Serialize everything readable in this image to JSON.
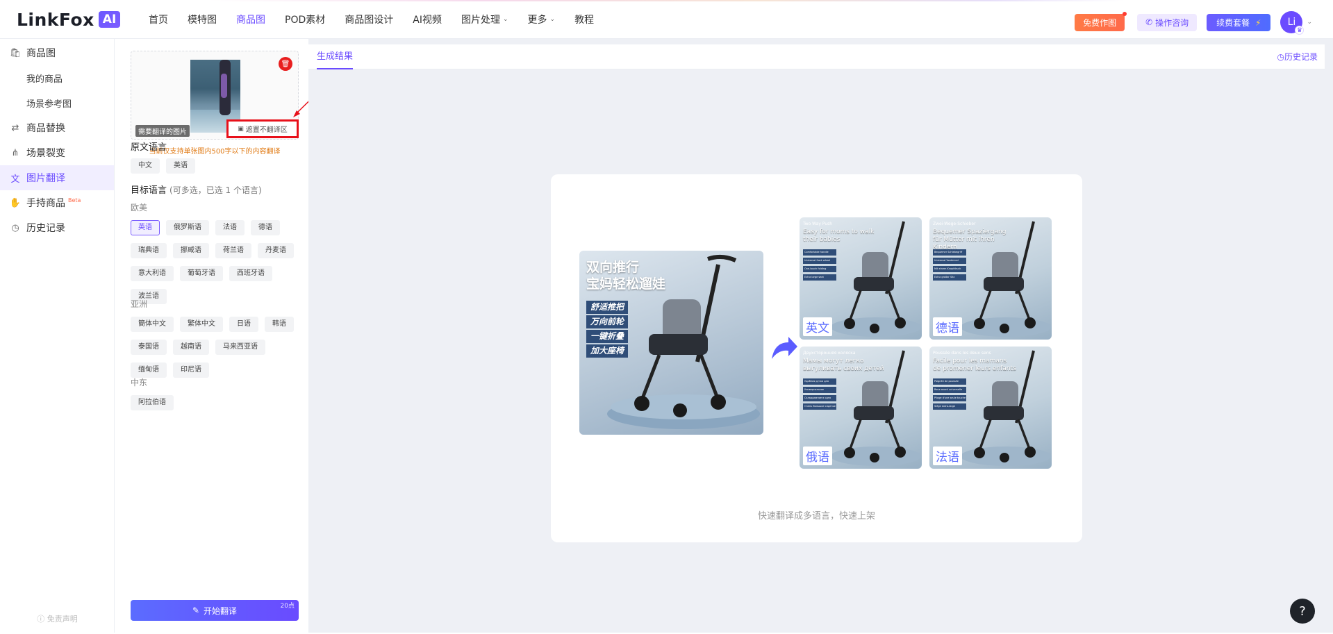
{
  "brand": {
    "word": "LinkFox",
    "ai": "AI"
  },
  "nav": [
    {
      "label": "首页",
      "active": false,
      "dropdown": false
    },
    {
      "label": "模特图",
      "active": false,
      "dropdown": false
    },
    {
      "label": "商品图",
      "active": true,
      "dropdown": false
    },
    {
      "label": "POD素材",
      "active": false,
      "dropdown": false
    },
    {
      "label": "商品图设计",
      "active": false,
      "dropdown": false
    },
    {
      "label": "AI视频",
      "active": false,
      "dropdown": false
    },
    {
      "label": "图片处理",
      "active": false,
      "dropdown": true
    },
    {
      "label": "更多",
      "active": false,
      "dropdown": true
    },
    {
      "label": "教程",
      "active": false,
      "dropdown": false
    }
  ],
  "topbar": {
    "free_label": "免费作图",
    "consult_label": "操作咨询",
    "renew_label": "续费套餐",
    "avatar_text": "Li"
  },
  "sidebar": {
    "items": [
      {
        "label": "商品图",
        "icon": "bag-icon",
        "sub": false,
        "active": false
      },
      {
        "label": "我的商品",
        "sub": true,
        "active": false
      },
      {
        "label": "场景参考图",
        "sub": true,
        "active": false
      },
      {
        "label": "商品替换",
        "icon": "swap-icon",
        "sub": false,
        "active": false
      },
      {
        "label": "场景裂变",
        "icon": "share-icon",
        "sub": false,
        "active": false
      },
      {
        "label": "图片翻译",
        "icon": "translate-icon",
        "sub": false,
        "active": true
      },
      {
        "label": "手持商品",
        "icon": "hand-icon",
        "sub": false,
        "active": false,
        "badge": "Beta"
      },
      {
        "label": "历史记录",
        "icon": "clock-icon",
        "sub": false,
        "active": false
      }
    ],
    "footer": "免责声明"
  },
  "panel": {
    "upload_tag": "需要翻译的图片",
    "mask_label": "遮置不翻译区",
    "notice": "当前仅支持单张图内500字以下的内容翻译",
    "source_title": "原文语言",
    "source_langs": [
      {
        "label": "中文",
        "active": false
      },
      {
        "label": "英语",
        "active": false
      }
    ],
    "target_title": "目标语言",
    "target_sub": "(可多选，已选 1 个语言)",
    "groups": [
      {
        "name": "欧美",
        "langs": [
          {
            "label": "英语",
            "active": true
          },
          {
            "label": "俄罗斯语",
            "active": false
          },
          {
            "label": "法语",
            "active": false
          },
          {
            "label": "德语",
            "active": false
          },
          {
            "label": "瑞典语",
            "active": false
          },
          {
            "label": "挪威语",
            "active": false
          },
          {
            "label": "荷兰语",
            "active": false
          },
          {
            "label": "丹麦语",
            "active": false
          },
          {
            "label": "意大利语",
            "active": false
          },
          {
            "label": "葡萄牙语",
            "active": false
          },
          {
            "label": "西班牙语",
            "active": false
          },
          {
            "label": "波兰语",
            "active": false
          }
        ]
      },
      {
        "name": "亚洲",
        "langs": [
          {
            "label": "簡体中文",
            "active": false
          },
          {
            "label": "繁体中文",
            "active": false
          },
          {
            "label": "日语",
            "active": false
          },
          {
            "label": "韩语",
            "active": false
          },
          {
            "label": "泰国语",
            "active": false
          },
          {
            "label": "越南语",
            "active": false
          },
          {
            "label": "马来西亚语",
            "active": false
          },
          {
            "label": "缅甸语",
            "active": false
          },
          {
            "label": "印尼语",
            "active": false
          }
        ]
      },
      {
        "name": "中东",
        "langs": [
          {
            "label": "阿拉伯语",
            "active": false
          }
        ]
      }
    ],
    "start_label": "开始翻译",
    "start_points": "20点"
  },
  "main": {
    "tab_label": "生成结果",
    "history_label": "历史记录",
    "demo": {
      "source_title_line1": "双向推行",
      "source_title_line2": "宝妈轻松遛娃",
      "source_features": [
        "舒适推把",
        "万向前轮",
        "一键折叠",
        "加大座椅"
      ],
      "tiles": [
        {
          "lang": "英文",
          "head": "Two Way Push",
          "headline": "Easy for moms to walk their babies",
          "features": [
            "Comfortable handle",
            "Universal front wheel",
            "One-touch folding",
            "Extra large seat"
          ]
        },
        {
          "lang": "德语",
          "head": "Zwei-Wege-Schieber",
          "headline": "Bequemer Spaziergang für Mütter mit ihren Kindern",
          "features": [
            "Bequemer Schiebegriff",
            "Universal Vorderrad",
            "Mit einem Knopfdruck zusammenklappbar",
            "Extra großer Sitz"
          ]
        },
        {
          "lang": "俄语",
          "head": "Двухсторонняя коляска",
          "headline": "Мамы могут легко выгуливать своих детей",
          "features": [
            "Удобная ручка для толкания",
            "Универсальное переднее колесо",
            "Складывание в одно касание",
            "Очень большое сиденье"
          ]
        },
        {
          "lang": "法语",
          "head": "Poussée dans les deux sens",
          "headline": "Facile pour les mamans de promener leurs enfants",
          "features": [
            "Poignée de poussée confortable",
            "Roue avant universelle",
            "Pliage d'une seule touche",
            "Siège extra-large"
          ]
        }
      ],
      "caption": "快速翻译成多语言，快速上架"
    }
  },
  "help_label": "?",
  "colors": {
    "accent": "#6a4bff",
    "danger": "#e8101a",
    "notice": "#e07a14"
  }
}
